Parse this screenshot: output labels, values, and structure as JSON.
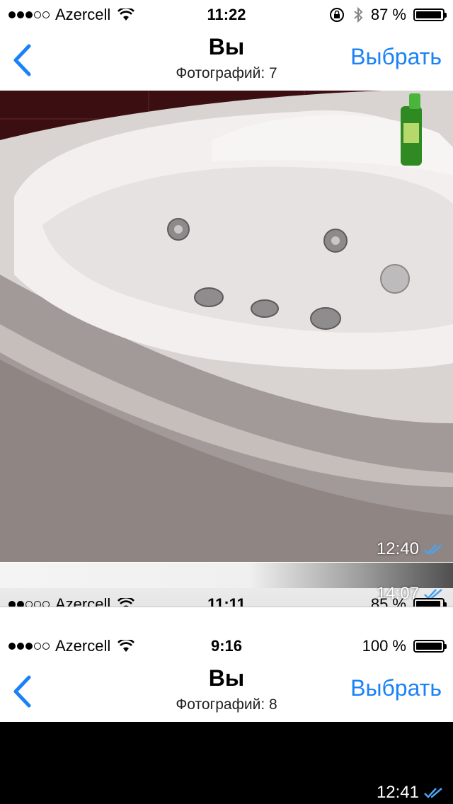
{
  "top": {
    "status": {
      "carrier": "Azercell",
      "time": "11:22",
      "battery": "87 %",
      "battery_level": 0.87
    },
    "nav": {
      "title": "Вы",
      "subtitle": "Фотографий: 7",
      "select": "Выбрать"
    },
    "photo_time": "12:40"
  },
  "middle": {
    "photo_time": "14:07",
    "status": {
      "carrier": "Azercell",
      "time": "11:11",
      "battery": "85 %"
    }
  },
  "bottom": {
    "status": {
      "carrier": "Azercell",
      "time": "9:16",
      "battery": "100 %",
      "battery_level": 1.0
    },
    "nav": {
      "title": "Вы",
      "subtitle": "Фотографий: 8",
      "select": "Выбрать"
    },
    "photo_time": "12:41"
  },
  "colors": {
    "accent": "#1a82f7",
    "check": "#4aa3f0"
  },
  "icons": [
    "signal-dots-icon",
    "wifi-icon",
    "rotation-lock-icon",
    "bluetooth-icon",
    "battery-icon",
    "chevron-left-icon",
    "double-check-icon"
  ]
}
